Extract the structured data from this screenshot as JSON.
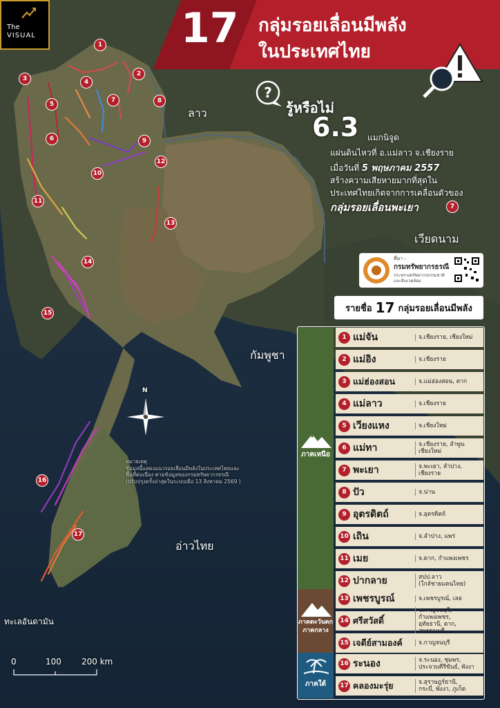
{
  "brand": {
    "line1": "The",
    "line2": "VISUAL"
  },
  "title": {
    "number": "17",
    "line1": "กลุ่มรอยเลื่อนมีพลัง",
    "line2": "ในประเทศไทย"
  },
  "did_you_know": {
    "heading": "รู้หรือไม่",
    "magnitude": "6.3",
    "magnitude_unit": "แมกนิจูด",
    "line1": "แผ่นดินไหวที่ อ.แม่ลาว จ.เชียงราย",
    "line2_prefix": "เมื่อวันที่",
    "line2_date": "5 พฤษภาคม 2557",
    "line3": "สร้างความเสียหายมากที่สุดใน",
    "line4": "ประเทศไทยเกิดจากการเคลื่อนตัวของ",
    "line5": "กลุ่มรอยเลื่อนพะเยา",
    "line5_badge": "7"
  },
  "map_labels": {
    "laos": "ลาว",
    "vietnam": "เวียดนาม",
    "cambodia": "กัมพูชา",
    "gulf": "อ่าวไทย",
    "andaman": "ทะเลอันดามัน"
  },
  "north_symbol": "N",
  "note": {
    "line1": "หมายเหตุ",
    "line2": "ข้อมูลนี้แสดงแนวรอยเลื่อนมีพลังในประเทศไทยและ",
    "line3": "พื้นที่ต่อเนื่อง  ตามข้อมูลของกรมทรัพยากรธรณี",
    "line4": "(ปรับปรุงครั้งล่าสุดในระบบเมื่อ 13 สิงหาคม 2569 )"
  },
  "scale": {
    "t0": "0",
    "t1": "100",
    "t2": "200 km"
  },
  "source": {
    "label": "ที่มา :",
    "org": "กรมทรัพยากรธรณี",
    "ministry1": "กระทรวงทรัพยากรธรรมชาติ",
    "ministry2": "และสิ่งแวดล้อม"
  },
  "list_header": {
    "prefix": "รายชื่อ",
    "count": "17",
    "suffix": "กลุ่มรอยเลื่อนมีพลัง"
  },
  "regions": [
    {
      "name": "ภาคเหนือ"
    },
    {
      "name": "ภาคตะวันตก",
      "name2": "ภาคกลาง"
    },
    {
      "name": "ภาคใต้"
    }
  ],
  "faults": [
    {
      "n": "1",
      "name": "แม่จัน",
      "prov": "จ.เชียงราย, เชียงใหม่"
    },
    {
      "n": "2",
      "name": "แม่อิง",
      "prov": "จ.เชียงราย"
    },
    {
      "n": "3",
      "name": "แม่ฮ่องสอน",
      "prov": "จ.แม่ฮ่องสอน, ตาก"
    },
    {
      "n": "4",
      "name": "แม่ลาว",
      "prov": "จ.เชียงราย"
    },
    {
      "n": "5",
      "name": "เวียงแหง",
      "prov": "จ.เชียงใหม่"
    },
    {
      "n": "6",
      "name": "แม่ทา",
      "prov": "จ.เชียงราย, ลำพูน",
      "prov2": "เชียงใหม่"
    },
    {
      "n": "7",
      "name": "พะเยา",
      "prov": "จ.พะเยา, ลำปาง,",
      "prov2": "เชียงราย"
    },
    {
      "n": "8",
      "name": "ปัว",
      "prov": "จ.น่าน"
    },
    {
      "n": "9",
      "name": "อุตรดิตถ์",
      "prov": "จ.อุตรดิตถ์"
    },
    {
      "n": "10",
      "name": "เถิน",
      "prov": "จ.ลำปาง, แพร่"
    },
    {
      "n": "11",
      "name": "เมย",
      "prov": "จ.ตาก, กำแพงเพชร"
    },
    {
      "n": "12",
      "name": "ปากลาย",
      "prov": "สปป.ลาว",
      "prov2": "(ใกล้ชายแดนไทย)"
    },
    {
      "n": "13",
      "name": "เพชรบูรณ์",
      "prov": "จ.เพชรบูรณ์, เลย"
    },
    {
      "n": "14",
      "name": "ศรีสวัสดิ์",
      "prov": "จ.กาญจนบุรี, กำแพงเพชร,",
      "prov2": "อุทัยธานี, ตาก, สุพรรณบุรี"
    },
    {
      "n": "15",
      "name": "เจดีย์สามองค์",
      "prov": "จ.กาญจนบุรี"
    },
    {
      "n": "16",
      "name": "ระนอง",
      "prov": "จ.ระนอง, ชุมพร,",
      "prov2": "ประจวบคีรีขันธ์, พังงา"
    },
    {
      "n": "17",
      "name": "คลองมะรุ่ย",
      "prov": "จ.สุราษฎร์ธานี,",
      "prov2": "กระบี่, พังงา, ภูเก็ต"
    }
  ],
  "colors": {
    "accent_red": "#b3202b",
    "north_green": "#4a6a35",
    "central_brown": "#6b4a35",
    "south_blue": "#1f5b80",
    "row_bg": "#ece4cf"
  }
}
